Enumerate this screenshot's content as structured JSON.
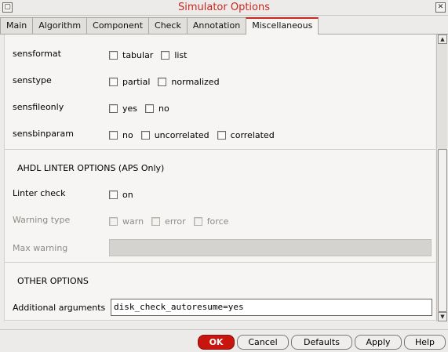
{
  "window": {
    "title": "Simulator Options",
    "menu_glyph": "▢",
    "close_glyph": "✕"
  },
  "tabs": [
    {
      "label": "Main"
    },
    {
      "label": "Algorithm"
    },
    {
      "label": "Component"
    },
    {
      "label": "Check"
    },
    {
      "label": "Annotation"
    },
    {
      "label": "Miscellaneous",
      "active": true
    }
  ],
  "sens": {
    "sensformat": {
      "label": "sensformat",
      "options": [
        "tabular",
        "list"
      ]
    },
    "senstype": {
      "label": "senstype",
      "options": [
        "partial",
        "normalized"
      ]
    },
    "sensfileonly": {
      "label": "sensfileonly",
      "options": [
        "yes",
        "no"
      ]
    },
    "sensbinparam": {
      "label": "sensbinparam",
      "options": [
        "no",
        "uncorrelated",
        "correlated"
      ]
    }
  },
  "ahdl": {
    "header": "AHDL LINTER OPTIONS (APS Only)",
    "linter_check": {
      "label": "Linter check",
      "options": [
        "on"
      ]
    },
    "warning_type": {
      "label": "Warning type",
      "options": [
        "warn",
        "error",
        "force"
      ]
    },
    "max_warning": {
      "label": "Max warning",
      "value": ""
    }
  },
  "other": {
    "header": "OTHER OPTIONS",
    "additional_arguments": {
      "label": "Additional arguments",
      "value": "disk_check_autoresume=yes"
    }
  },
  "buttons": {
    "ok": "OK",
    "cancel": "Cancel",
    "defaults": "Defaults",
    "apply": "Apply",
    "help": "Help"
  },
  "colors": {
    "title": "#c9281e",
    "ok_button": "#c8160f",
    "active_tab_accent": "#c9281e"
  }
}
